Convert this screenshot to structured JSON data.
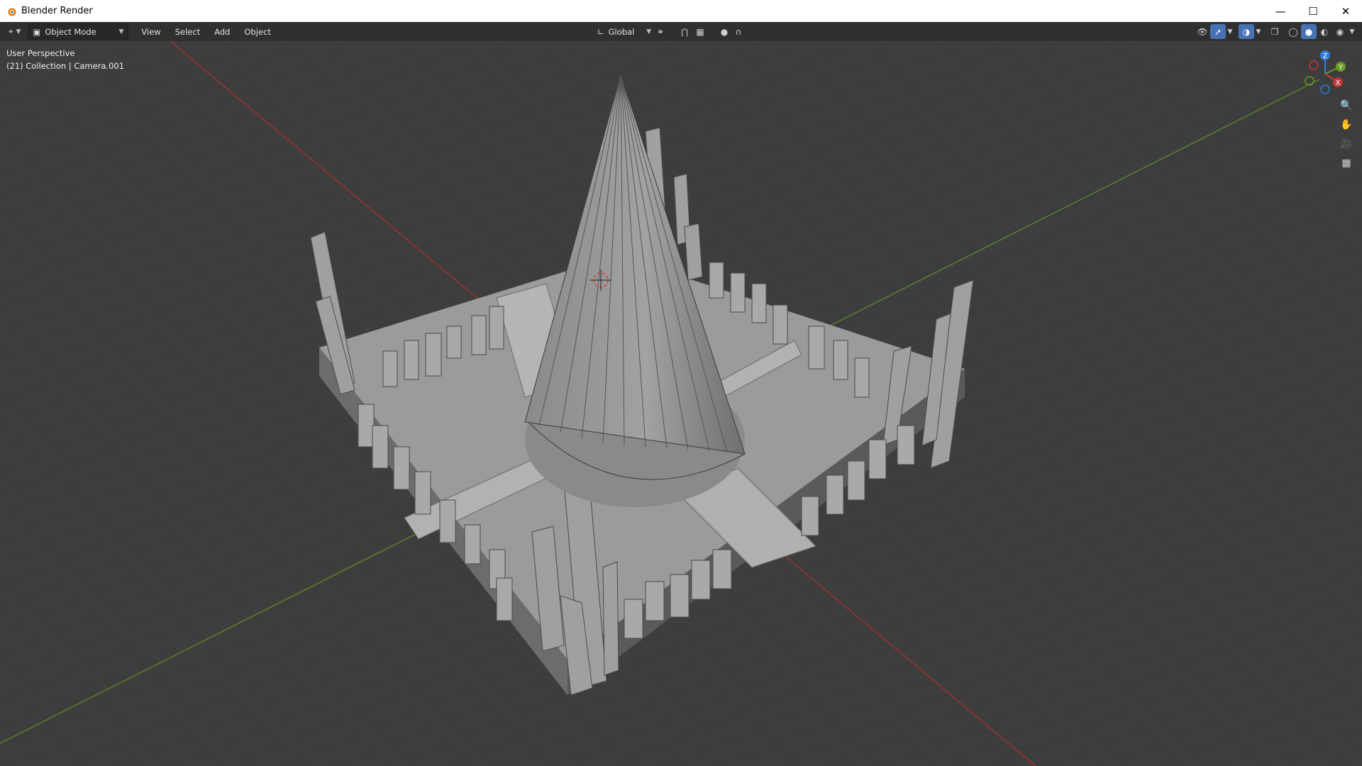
{
  "window": {
    "title": "Blender Render"
  },
  "header": {
    "mode": "Object Mode",
    "menus": [
      "View",
      "Select",
      "Add",
      "Object"
    ],
    "transform_orientation": "Global"
  },
  "viewport": {
    "perspective_label": "User Perspective",
    "collection_label": "(21) Collection | Camera.001"
  },
  "gizmo": {
    "axes": [
      "X",
      "Y",
      "Z"
    ]
  },
  "colors": {
    "x_axis": "#c0393b",
    "y_axis": "#6b9b2a",
    "z_axis": "#2f7ed8",
    "accent": "#4772b3"
  },
  "icons": [
    "blender-logo-icon",
    "editor-type-icon",
    "object-mode-icon",
    "orientation-icon",
    "pivot-icon",
    "snap-icon",
    "proportional-icon",
    "visibility-icon",
    "gizmo-icon",
    "overlay-icon",
    "xray-icon",
    "wireframe-shading-icon",
    "solid-shading-icon",
    "material-shading-icon",
    "rendered-shading-icon",
    "zoom-icon",
    "pan-hand-icon",
    "camera-view-icon",
    "ortho-grid-icon"
  ]
}
